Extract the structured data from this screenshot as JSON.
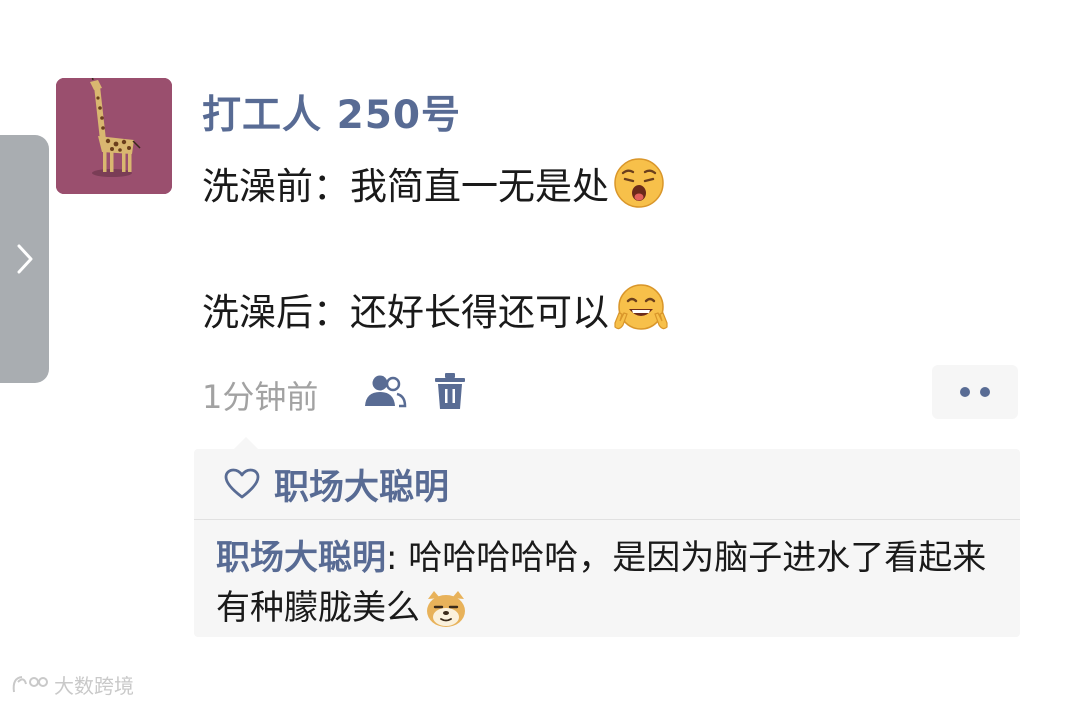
{
  "post": {
    "username": "打工人 250号",
    "line1": "洗澡前：我简直一无是处",
    "line1_emoji": "yawning-face-emoji",
    "line2": "洗澡后：还好长得还可以",
    "line2_emoji": "peace-face-emoji",
    "time": "1分钟前",
    "visibility_icon": "friends-icon",
    "delete_icon": "trash-icon",
    "more_icon": "two-dots-icon"
  },
  "likes": {
    "icon": "heart-icon",
    "names": "职场大聪明"
  },
  "comments": [
    {
      "author": "职场大聪明",
      "separator": ": ",
      "text": "哈哈哈哈哈，是因为脑子进水了看起来有种朦胧美么",
      "emoji": "doge-emoji"
    }
  ],
  "watermark": {
    "text": "大数跨境"
  },
  "colors": {
    "link": "#586b94",
    "text": "#1a1a1a",
    "meta": "#a2a2a2",
    "comment_bg": "#f6f6f6",
    "side_tab": "#a9adb1",
    "avatar_bg": "#9a4f6e"
  }
}
